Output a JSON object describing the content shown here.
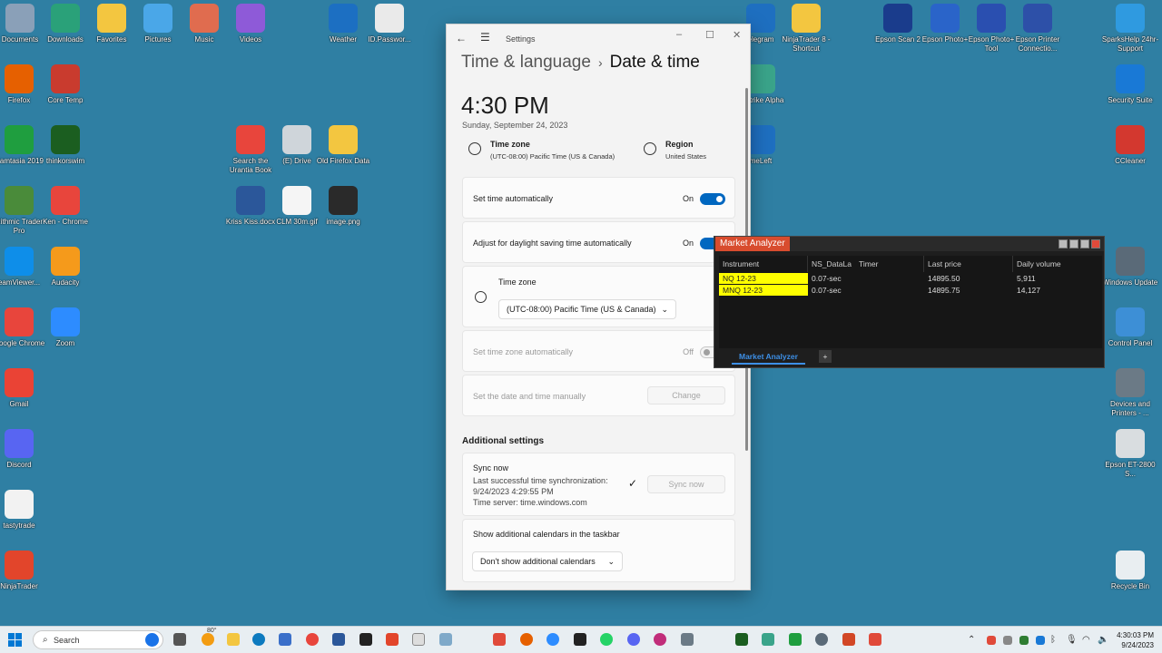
{
  "desktop_icons": [
    {
      "label": "Documents",
      "icon": "folder-icon",
      "color": "#8aa0b8"
    },
    {
      "label": "Downloads",
      "icon": "download-icon",
      "color": "#2aa179"
    },
    {
      "label": "Favorites",
      "icon": "folder-icon",
      "color": "#f3c640"
    },
    {
      "label": "Pictures",
      "icon": "pictures-icon",
      "color": "#4aa7e8"
    },
    {
      "label": "Music",
      "icon": "music-icon",
      "color": "#e06c4f"
    },
    {
      "label": "Videos",
      "icon": "videos-icon",
      "color": "#8e5ad8"
    },
    {
      "label": "Weather",
      "icon": "weather-icon",
      "color": "#1c6fc2"
    },
    {
      "label": "ID.Passwor...",
      "icon": "document-icon",
      "color": "#eaeaea"
    },
    {
      "label": "elegram",
      "icon": "app-icon",
      "color": "#1e6fc0"
    },
    {
      "label": "NinjaTrader 8 - Shortcut",
      "icon": "folder-icon",
      "color": "#f3c640"
    },
    {
      "label": "Epson Scan 2",
      "icon": "scanner-icon",
      "color": "#1a3c8c"
    },
    {
      "label": "Epson Photo+",
      "icon": "photo-icon",
      "color": "#2a64c9"
    },
    {
      "label": "Epson Photo+ Tool",
      "icon": "photo-tool-icon",
      "color": "#2a4fb0"
    },
    {
      "label": "Epson Printer Connectio...",
      "icon": "printer-icon",
      "color": "#2d50a8"
    },
    {
      "label": "SparksHelp 24hr-Support",
      "icon": "support-icon",
      "color": "#2f9ae0"
    },
    {
      "label": "Firefox",
      "icon": "firefox-icon",
      "color": "#e66000"
    },
    {
      "label": "Core Temp",
      "icon": "thermometer-icon",
      "color": "#c93b2e"
    },
    {
      "label": "ckStrike Alpha",
      "icon": "app-icon",
      "color": "#3aa48a"
    },
    {
      "label": "Security Suite",
      "icon": "lock-icon",
      "color": "#1979d6"
    },
    {
      "label": "Camtasia 2019",
      "icon": "camtasia-icon",
      "color": "#1f9e3f"
    },
    {
      "label": "thinkorswim",
      "icon": "thinkorswim-icon",
      "color": "#1b5e20"
    },
    {
      "label": "Search the Urantia Book",
      "icon": "chrome-icon",
      "color": "#e8453c"
    },
    {
      "label": "(E) Drive",
      "icon": "drive-icon",
      "color": "#cfd5da"
    },
    {
      "label": "Old Firefox Data",
      "icon": "folder-icon",
      "color": "#f3c640"
    },
    {
      "label": "meLeft",
      "icon": "app-icon",
      "color": "#1e6fc0"
    },
    {
      "label": "CCleaner",
      "icon": "ccleaner-icon",
      "color": "#d3382f"
    },
    {
      "label": "Rithmic Trader Pro",
      "icon": "rithmic-icon",
      "color": "#4a8b3a"
    },
    {
      "label": "Ken - Chrome",
      "icon": "chrome-icon",
      "color": "#e8453c"
    },
    {
      "label": "Kriss Kiss.docx",
      "icon": "word-icon",
      "color": "#2b579a"
    },
    {
      "label": "CLM 30m.gif",
      "icon": "image-icon",
      "color": "#f5f5f5"
    },
    {
      "label": "image.png",
      "icon": "image-icon",
      "color": "#2a2a2a"
    },
    {
      "label": "eamViewer...",
      "icon": "teamviewer-icon",
      "color": "#0e8ee9"
    },
    {
      "label": "Audacity",
      "icon": "audacity-icon",
      "color": "#f59a1b"
    },
    {
      "label": "Windows Update",
      "icon": "gear-icon",
      "color": "#5a6a78"
    },
    {
      "label": "Google Chrome",
      "icon": "chrome-icon",
      "color": "#e8453c"
    },
    {
      "label": "Zoom",
      "icon": "zoom-icon",
      "color": "#2d8cff"
    },
    {
      "label": "Control Panel",
      "icon": "control-panel-icon",
      "color": "#3d8fd6"
    },
    {
      "label": "Gmail",
      "icon": "gmail-icon",
      "color": "#ea4335"
    },
    {
      "label": "Devices and Printers - ...",
      "icon": "printer-icon",
      "color": "#6b7a86"
    },
    {
      "label": "Discord",
      "icon": "discord-icon",
      "color": "#5865f2"
    },
    {
      "label": "Epson ET-2800 S...",
      "icon": "printer-icon",
      "color": "#d9dde0"
    },
    {
      "label": "tastytrade",
      "icon": "tastytrade-icon",
      "color": "#f2f2f2"
    },
    {
      "label": "NinjaTrader",
      "icon": "ninjatrader-icon",
      "color": "#e2452b"
    },
    {
      "label": "Recycle Bin",
      "icon": "recycle-bin-icon",
      "color": "#e9eef1"
    }
  ],
  "settings": {
    "window_title": "Settings",
    "breadcrumb_parent": "Time & language",
    "breadcrumb_sep": "›",
    "page_title": "Date & time",
    "clock": "4:30 PM",
    "date": "Sunday, September 24, 2023",
    "tz_heading": "Time zone",
    "tz_value": "(UTC-08:00) Pacific Time (US & Canada)",
    "region_heading": "Region",
    "region_value": "United States",
    "set_time_auto": {
      "label": "Set time automatically",
      "state": "On"
    },
    "dst_auto": {
      "label": "Adjust for daylight saving time automatically",
      "state": "On"
    },
    "time_zone_card": {
      "label": "Time zone",
      "dropdown": "(UTC-08:00) Pacific Time (US & Canada)"
    },
    "tz_auto": {
      "label": "Set time zone automatically",
      "state": "Off"
    },
    "manual": {
      "label": "Set the date and time manually",
      "button": "Change"
    },
    "additional_heading": "Additional settings",
    "sync": {
      "title": "Sync now",
      "line1": "Last successful time synchronization:",
      "line2": "9/24/2023 4:29:55 PM",
      "line3": "Time server: time.windows.com",
      "button": "Sync now"
    },
    "calendars": {
      "label": "Show additional calendars in the taskbar",
      "dropdown": "Don't show additional calendars"
    }
  },
  "market_analyzer": {
    "title": "Market Analyzer",
    "columns": [
      "Instrument",
      "NS_DataLa",
      "Timer",
      "Last price",
      "Daily volume"
    ],
    "rows": [
      {
        "instrument": "NQ 12-23",
        "timer": "0.07-sec",
        "last": "14895.50",
        "volume": "5,911"
      },
      {
        "instrument": "MNQ 12-23",
        "timer": "0.07-sec",
        "last": "14895.75",
        "volume": "14,127"
      }
    ],
    "tab": "Market Analyzer",
    "add_tab": "+"
  },
  "taskbar": {
    "search_placeholder": "Search",
    "weather_temp": "80°",
    "time": "4:30:03 PM",
    "date": "9/24/2023"
  }
}
